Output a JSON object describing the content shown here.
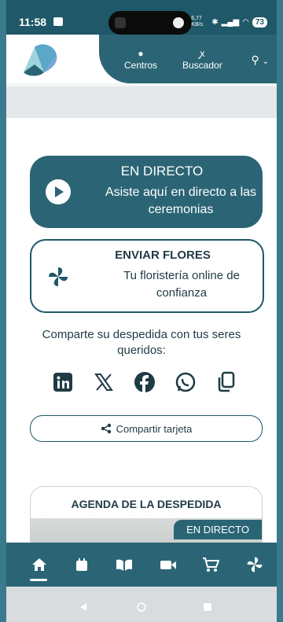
{
  "status": {
    "time": "11:58",
    "battery": "73",
    "speed": "6,77 KB/s"
  },
  "header": {
    "nav": [
      {
        "label": "Centros",
        "icon": "location-pin-icon"
      },
      {
        "label": "Buscador",
        "icon": "ribbon-icon"
      }
    ]
  },
  "live": {
    "title": "EN DIRECTO",
    "text": "Asiste aquí en directo a las ceremonias"
  },
  "flores": {
    "title": "ENVIAR FLORES",
    "text": "Tu floristería online de confianza"
  },
  "share": {
    "text": "Comparte su despedida con tus seres queridos:",
    "button": "Compartir tarjeta",
    "icons": [
      "linkedin-icon",
      "x-icon",
      "facebook-icon",
      "whatsapp-icon",
      "copy-icon"
    ]
  },
  "agenda": {
    "title": "AGENDA DE LA DESPEDIDA",
    "badge": "EN DIRECTO"
  },
  "bottom_nav": [
    "home-icon",
    "calendar-icon",
    "book-icon",
    "video-icon",
    "cart-icon",
    "pinwheel-icon"
  ],
  "colors": {
    "primary": "#2b6575",
    "dark": "#1f5868",
    "text": "#1f3b45"
  }
}
